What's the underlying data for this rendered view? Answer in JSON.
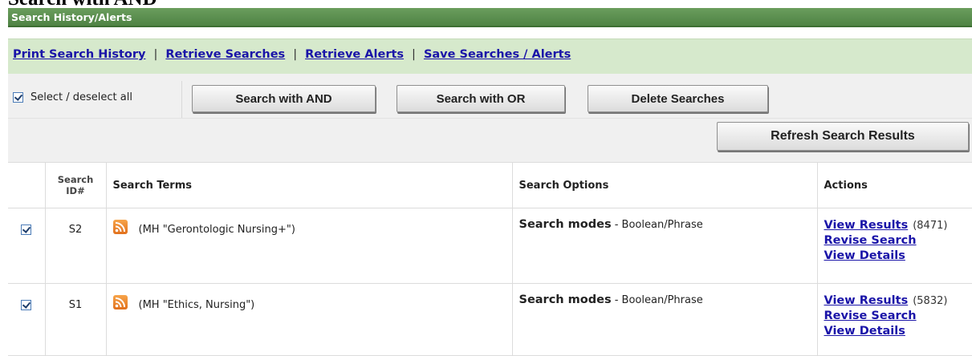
{
  "page_heading": "Search with AND",
  "panel": {
    "title": "Search History/Alerts"
  },
  "links": [
    "Print Search History",
    "Retrieve Searches",
    "Retrieve Alerts",
    "Save Searches / Alerts"
  ],
  "link_separator": "|",
  "toolbar": {
    "select_all_label": "Select / deselect all",
    "select_all_checked": true,
    "buttons": [
      "Search with AND",
      "Search with OR",
      "Delete Searches"
    ],
    "refresh_label": "Refresh Search Results"
  },
  "table": {
    "headers": {
      "search_id_line1": "Search",
      "search_id_line2": "ID#",
      "search_terms": "Search Terms",
      "search_options": "Search Options",
      "actions": "Actions"
    },
    "rows": [
      {
        "id": "S2",
        "checked": true,
        "term": "(MH \"Gerontologic Nursing+\")",
        "options_label": "Search modes",
        "options_value": "- Boolean/Phrase",
        "view_results": "View Results",
        "count": "(8471)",
        "revise": "Revise Search",
        "details": "View Details"
      },
      {
        "id": "S1",
        "checked": true,
        "term": "(MH \"Ethics, Nursing\")",
        "options_label": "Search modes",
        "options_value": "- Boolean/Phrase",
        "view_results": "View Results",
        "count": "(5832)",
        "revise": "Revise Search",
        "details": "View Details"
      }
    ]
  },
  "colors": {
    "header_green": "#4f8344",
    "link_bar": "#d6e9cc",
    "link_blue": "#1a14a8",
    "toolbar_bg": "#f0f0f0"
  },
  "icons": {
    "row_icon": "rss-feed-icon",
    "checkbox": "checkbox-checked-icon"
  }
}
